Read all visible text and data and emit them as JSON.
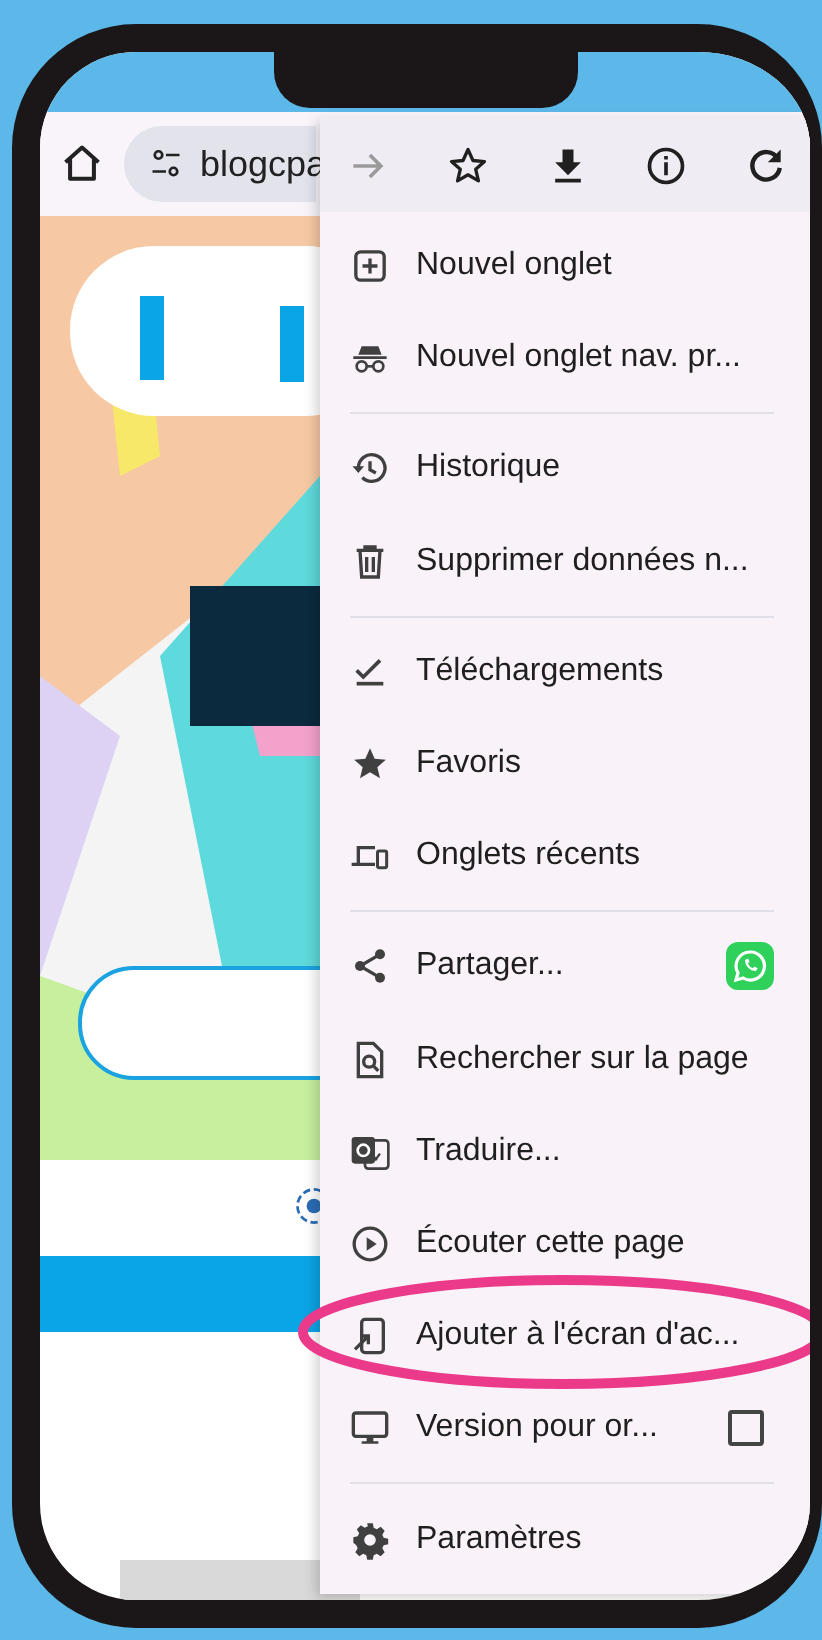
{
  "browser": {
    "url": "blogcpa"
  },
  "menu": {
    "toolbar": [
      {
        "disabled": true
      },
      {
        "disabled": false
      },
      {
        "disabled": false
      },
      {
        "disabled": false
      },
      {
        "disabled": false
      }
    ],
    "sections": [
      {
        "items": [
          {
            "kind": "plain",
            "label": "Nouvel onglet",
            "circled": false
          },
          {
            "kind": "plain",
            "label": "Nouvel onglet nav. pr...",
            "circled": false
          }
        ]
      },
      {
        "items": [
          {
            "kind": "plain",
            "label": "Historique",
            "circled": false
          },
          {
            "kind": "plain",
            "label": "Supprimer données n...",
            "circled": false
          }
        ]
      },
      {
        "items": [
          {
            "kind": "plain",
            "label": "Téléchargements",
            "circled": false
          },
          {
            "kind": "plain",
            "label": "Favoris",
            "circled": false
          },
          {
            "kind": "plain",
            "label": "Onglets récents",
            "circled": false
          }
        ]
      },
      {
        "items": [
          {
            "kind": "share",
            "label": "Partager...",
            "circled": false
          },
          {
            "kind": "plain",
            "label": "Rechercher sur la page",
            "circled": false
          },
          {
            "kind": "plain",
            "label": "Traduire...",
            "circled": false
          },
          {
            "kind": "plain",
            "label": "Écouter cette page",
            "circled": false
          },
          {
            "kind": "plain",
            "label": "Ajouter à l'écran d'ac...",
            "circled": true
          },
          {
            "kind": "checkbox",
            "label": "Version pour or...",
            "checked": false,
            "circled": false
          }
        ]
      },
      {
        "items": [
          {
            "kind": "plain",
            "label": "Paramètres",
            "circled": false
          }
        ]
      }
    ]
  }
}
